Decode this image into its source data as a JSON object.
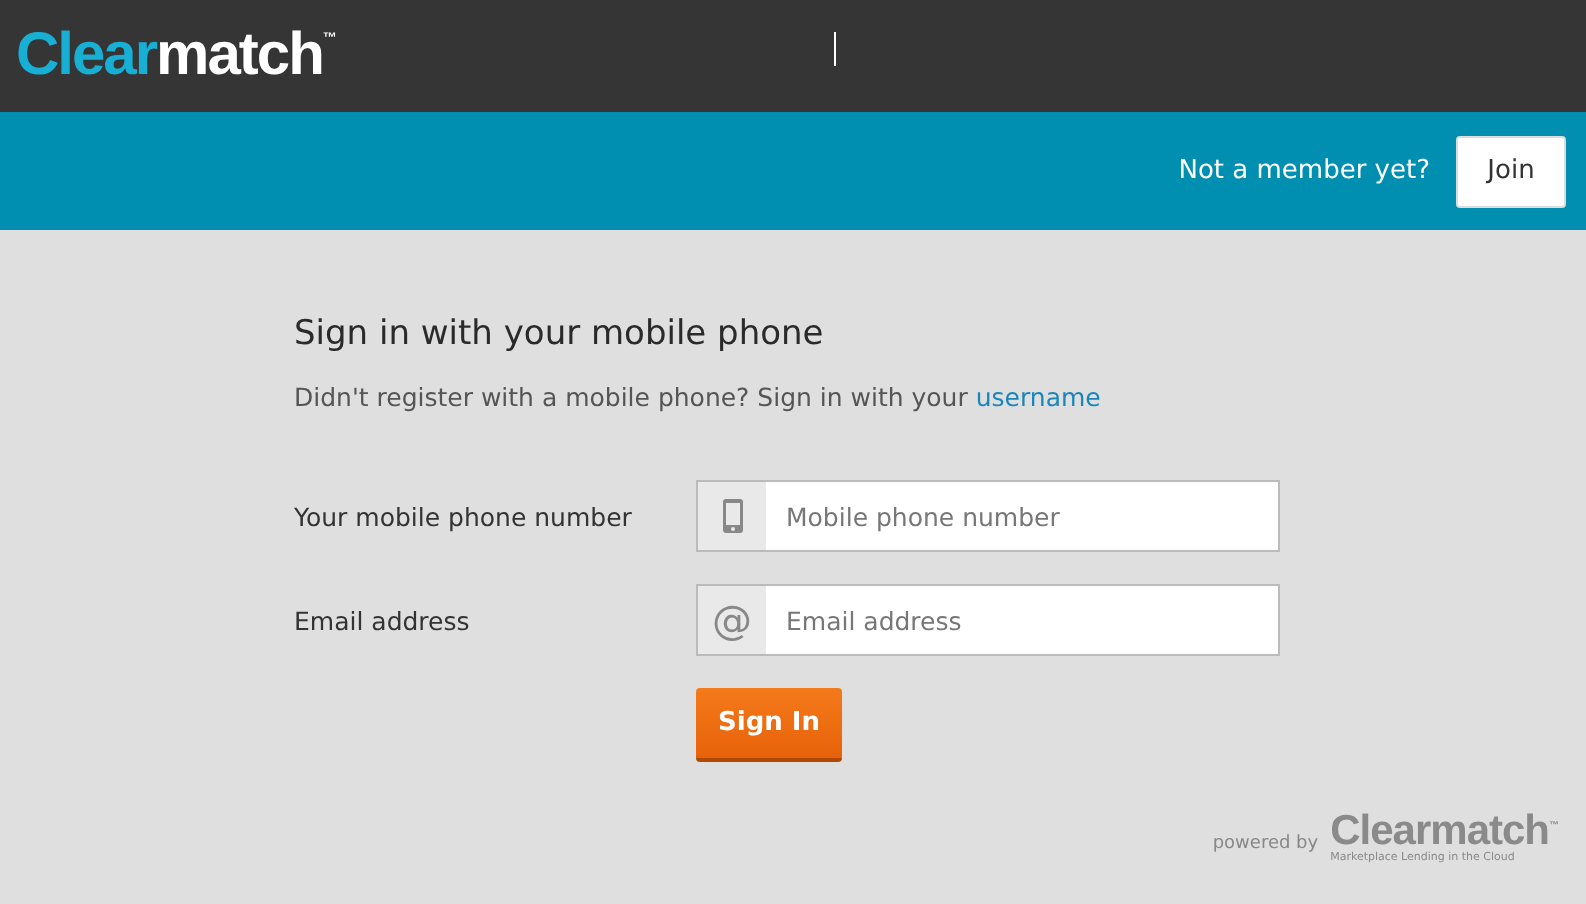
{
  "header": {
    "logo": {
      "first": "Clear",
      "second": "match",
      "mark": "™"
    }
  },
  "member_bar": {
    "prompt": "Not a member yet?",
    "join_button": "Join"
  },
  "form": {
    "title": "Sign in with your mobile phone",
    "subtitle": "Didn't register with a mobile phone? Sign in with your",
    "subtitle_link": "username",
    "fields": [
      {
        "label": "Your mobile phone number",
        "kind": "phone",
        "placeholder": "Mobile phone number"
      },
      {
        "label": "Email address",
        "kind": "email",
        "icon_text": "@",
        "placeholder": "Email address"
      }
    ],
    "submit": "Sign In"
  },
  "footer": {
    "powered_by": "powered by",
    "logo": "Clearmatch",
    "mark": "™",
    "tagline": "Marketplace Lending in the Cloud"
  }
}
